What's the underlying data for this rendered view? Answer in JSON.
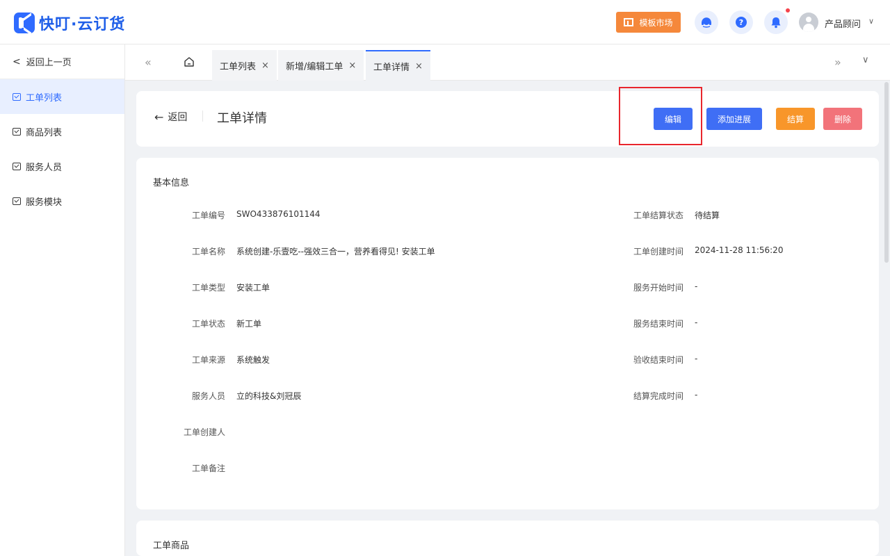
{
  "app": {
    "name": "快叮·云订货"
  },
  "header": {
    "template_market": "模板市场",
    "user_name": "产品顾问",
    "caret": "∨"
  },
  "sidebar": {
    "back": "返回上一页",
    "items": [
      {
        "label": "工单列表",
        "active": true
      },
      {
        "label": "商品列表",
        "active": false
      },
      {
        "label": "服务人员",
        "active": false
      },
      {
        "label": "服务模块",
        "active": false
      }
    ]
  },
  "tabs": [
    {
      "label": "工单列表",
      "close": "×"
    },
    {
      "label": "新增/编辑工单",
      "close": "×"
    },
    {
      "label": "工单详情",
      "close": "×",
      "active": true
    }
  ],
  "page": {
    "back_label": "返回",
    "title": "工单详情",
    "actions": {
      "edit": "编辑",
      "add_progress": "添加进展",
      "settle": "结算",
      "delete": "删除"
    }
  },
  "basic_info": {
    "title": "基本信息",
    "left_fields": [
      {
        "label": "工单编号",
        "value": "SWO433876101144"
      },
      {
        "label": "工单名称",
        "value": "系统创建-乐壹吃--强效三合一，营养看得见! 安装工单"
      },
      {
        "label": "工单类型",
        "value": "安装工单"
      },
      {
        "label": "工单状态",
        "value": "新工单"
      },
      {
        "label": "工单来源",
        "value": "系统触发"
      },
      {
        "label": "服务人员",
        "value": "立的科技&刘冠辰"
      },
      {
        "label": "工单创建人",
        "value": ""
      },
      {
        "label": "工单备注",
        "value": ""
      }
    ],
    "right_fields": [
      {
        "label": "工单结算状态",
        "value": "待结算"
      },
      {
        "label": "工单创建时间",
        "value": "2024-11-28 11:56:20"
      },
      {
        "label": "服务开始时间",
        "value": "-"
      },
      {
        "label": "服务结束时间",
        "value": "-"
      },
      {
        "label": "验收结束时间",
        "value": "-"
      },
      {
        "label": "结算完成时间",
        "value": "-"
      }
    ]
  },
  "goods": {
    "title": "工单商品"
  },
  "colors": {
    "primary": "#3f6ef5",
    "orange": "#f8962a",
    "danger": "#f2737a",
    "template_btn": "#f5883b",
    "highlight": "#e8262d"
  }
}
